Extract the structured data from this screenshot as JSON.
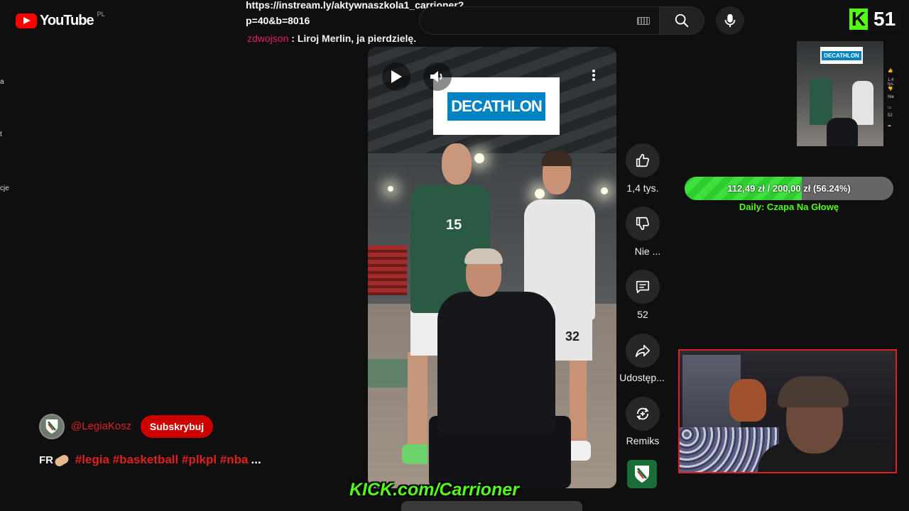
{
  "header": {
    "logo_text": "YouTube",
    "country_code": "PL",
    "url_line1": "https://instream.ly/aktywnaszkola1_carrioner?",
    "url_line2": "p=40&b=8016"
  },
  "left_stubs": [
    "a",
    "t",
    "cje"
  ],
  "kick": {
    "viewer_count": "51",
    "banner_text": "KICK.com/Carrioner",
    "brand_color": "#53fc18"
  },
  "chat": {
    "user": "zdwojson",
    "separator": " : ",
    "message": "Liroj Merlin, ja pierdzielę."
  },
  "video": {
    "sponsor_logo": "DECATHLON",
    "left_jersey_number": "15",
    "right_shorts_number": "32"
  },
  "actions": {
    "like_count": "1,4 tys.",
    "dislike_label": "Nie ...",
    "comment_count": "52",
    "share_label": "Udostęp...",
    "remix_label": "Remiks"
  },
  "channel": {
    "handle": "@LegiaKosz",
    "subscribe_label": "Subskrybuj"
  },
  "description": {
    "prefix": "FR",
    "hashtags": "#legia #basketball #plkpl #nba",
    "more": "..."
  },
  "mini_preview": {
    "sponsor_logo": "DECATHLON",
    "rail_texts": [
      "1,4 tys.",
      "Nie",
      "52"
    ]
  },
  "donation_goal": {
    "text": "112,49 zł / 200,00 zł (56.24%)",
    "percent": 56.24,
    "label": "Daily: Czapa Na Głowę"
  },
  "colors": {
    "youtube_red": "#ff0000",
    "subscribe_red": "#cc0000",
    "decathlon_blue": "#0082c3",
    "goal_green": "#2ecc2e",
    "cam_border": "#e02020"
  }
}
